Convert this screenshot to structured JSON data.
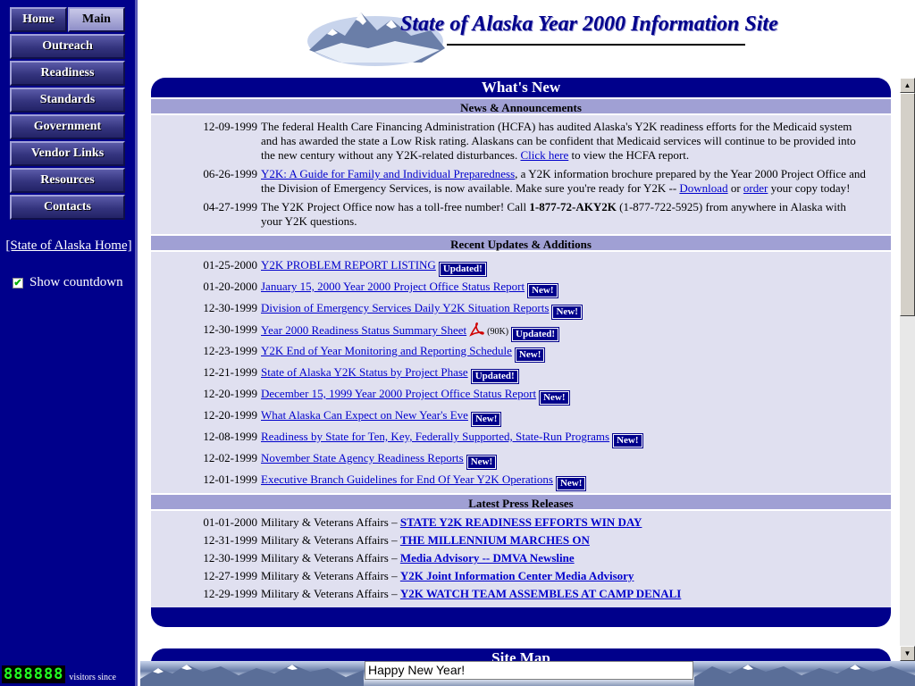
{
  "nav": {
    "home": "Home",
    "main": "Main",
    "items": [
      "Outreach",
      "Readiness",
      "Standards",
      "Government",
      "Vendor Links",
      "Resources",
      "Contacts"
    ],
    "state_home": "[State of Alaska Home]",
    "countdown_label": "Show countdown",
    "countdown_checked": true,
    "counter": "888888",
    "counter_label": "visitors since"
  },
  "banner": {
    "title": "State of Alaska Year 2000 Information Site"
  },
  "whats_new": {
    "title": "What's New",
    "news_heading": "News & Announcements",
    "news": [
      {
        "date": "12-09-1999",
        "text_before": "The federal Health Care Financing Administration (HCFA) has audited Alaska's Y2K readiness efforts for the Medicaid system and has awarded the state a Low Risk rating. Alaskans can be confident that Medicaid services will continue to be provided into the new century without any Y2K-related disturbances. ",
        "link": "Click here",
        "text_after": " to view the HCFA report."
      },
      {
        "date": "06-26-1999",
        "link1": "Y2K: A Guide for Family and Individual Preparedness",
        "text1": ", a Y2K information brochure prepared by the Year 2000 Project Office and the Division of Emergency Services, is now available. Make sure you're ready for Y2K -- ",
        "link2": "Download",
        "text2": " or ",
        "link3": "order",
        "text3": " your copy today!"
      },
      {
        "date": "04-27-1999",
        "text1": "The Y2K Project Office now has a toll-free number! Call ",
        "bold": "1-877-72-AKY2K",
        "text2": " (1-877-722-5925) from anywhere in Alaska with your Y2K questions."
      }
    ],
    "updates_heading": "Recent Updates & Additions",
    "updates": [
      {
        "date": "01-25-2000",
        "title": "Y2K PROBLEM REPORT LISTING",
        "badge": "Updated!"
      },
      {
        "date": "01-20-2000",
        "title": "January 15, 2000 Year 2000 Project Office Status Report",
        "badge": "New!"
      },
      {
        "date": "12-30-1999",
        "title": "Division of Emergency Services Daily Y2K Situation Reports",
        "badge": "New!"
      },
      {
        "date": "12-30-1999",
        "title": "Year 2000 Readiness Status Summary Sheet",
        "size": "(90K)",
        "badge": "Updated!"
      },
      {
        "date": "12-23-1999",
        "title": "Y2K End of Year Monitoring and Reporting Schedule",
        "badge": "New!"
      },
      {
        "date": "12-21-1999",
        "title": "State of Alaska Y2K Status by Project Phase",
        "badge": "Updated!"
      },
      {
        "date": "12-20-1999",
        "title": "December 15, 1999 Year 2000 Project Office Status Report",
        "badge": "New!"
      },
      {
        "date": "12-20-1999",
        "title": "What Alaska Can Expect on New Year's Eve",
        "badge": "New!"
      },
      {
        "date": "12-08-1999",
        "title": "Readiness by State for Ten, Key, Federally Supported, State-Run Programs",
        "badge": "New!"
      },
      {
        "date": "12-02-1999",
        "title": "November State Agency Readiness Reports",
        "badge": "New!"
      },
      {
        "date": "12-01-1999",
        "title": "Executive Branch Guidelines for End Of Year Y2K Operations",
        "badge": "New!"
      }
    ],
    "press_heading": "Latest Press Releases",
    "press": [
      {
        "date": "01-01-2000",
        "source": "Military & Veterans Affairs – ",
        "title": "STATE Y2K READINESS EFFORTS WIN DAY"
      },
      {
        "date": "12-31-1999",
        "source": "Military & Veterans Affairs – ",
        "title": "THE MILLENNIUM MARCHES ON"
      },
      {
        "date": "12-30-1999",
        "source": "Military & Veterans Affairs – ",
        "title": "Media Advisory -- DMVA Newsline"
      },
      {
        "date": "12-27-1999",
        "source": "Military & Veterans Affairs – ",
        "title": "Y2K Joint Information Center Media Advisory"
      },
      {
        "date": "12-29-1999",
        "source": "Military & Veterans Affairs – ",
        "title": "Y2K WATCH TEAM ASSEMBLES AT CAMP DENALI"
      }
    ]
  },
  "site_map": {
    "title": "Site Map"
  },
  "status_bar": {
    "message": "Happy New Year!"
  },
  "colors": {
    "navy": "#00008b",
    "section_head": "#a0a0d4",
    "section_body": "#e0e0f0",
    "link": "#0000cc"
  }
}
